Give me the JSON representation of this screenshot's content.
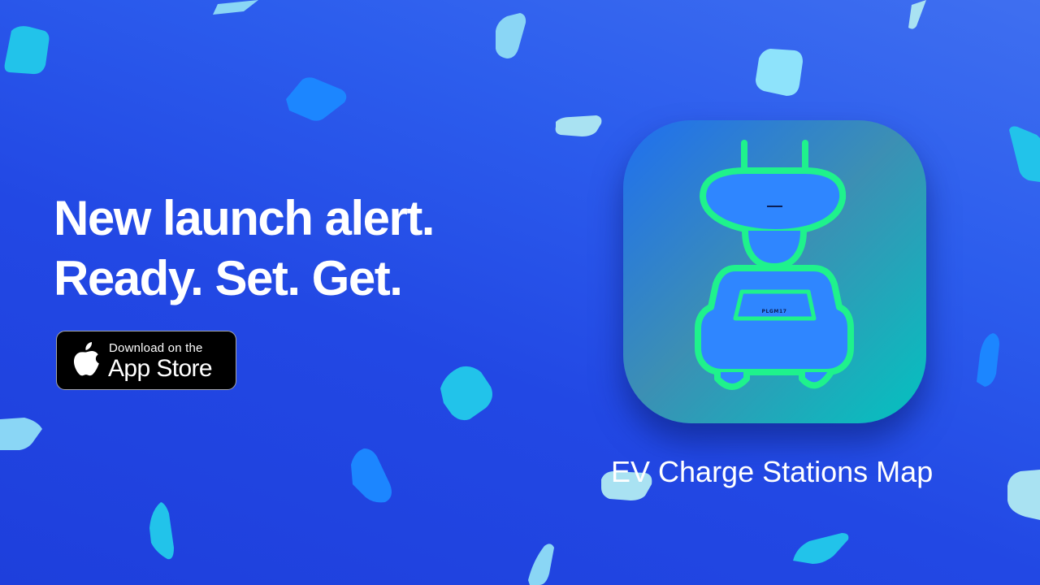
{
  "headline": {
    "line1": "New launch alert.",
    "line2": "Ready. Set. Get."
  },
  "app_store_badge": {
    "small_text": "Download on the",
    "big_text": "App Store",
    "icon": "apple-logo-icon"
  },
  "app": {
    "name": "EV Charge Stations Map",
    "icon": "ev-car-plug-icon",
    "plate_text": "PLGM17",
    "neon_color": "#1ff28c",
    "icon_fill_color": "#2f86ff"
  },
  "colors": {
    "background": "#2248e4",
    "text": "#ffffff",
    "shape_light": "#8ad6f5",
    "shape_cyan": "#22c3ea",
    "shape_blue": "#1c86ff"
  }
}
